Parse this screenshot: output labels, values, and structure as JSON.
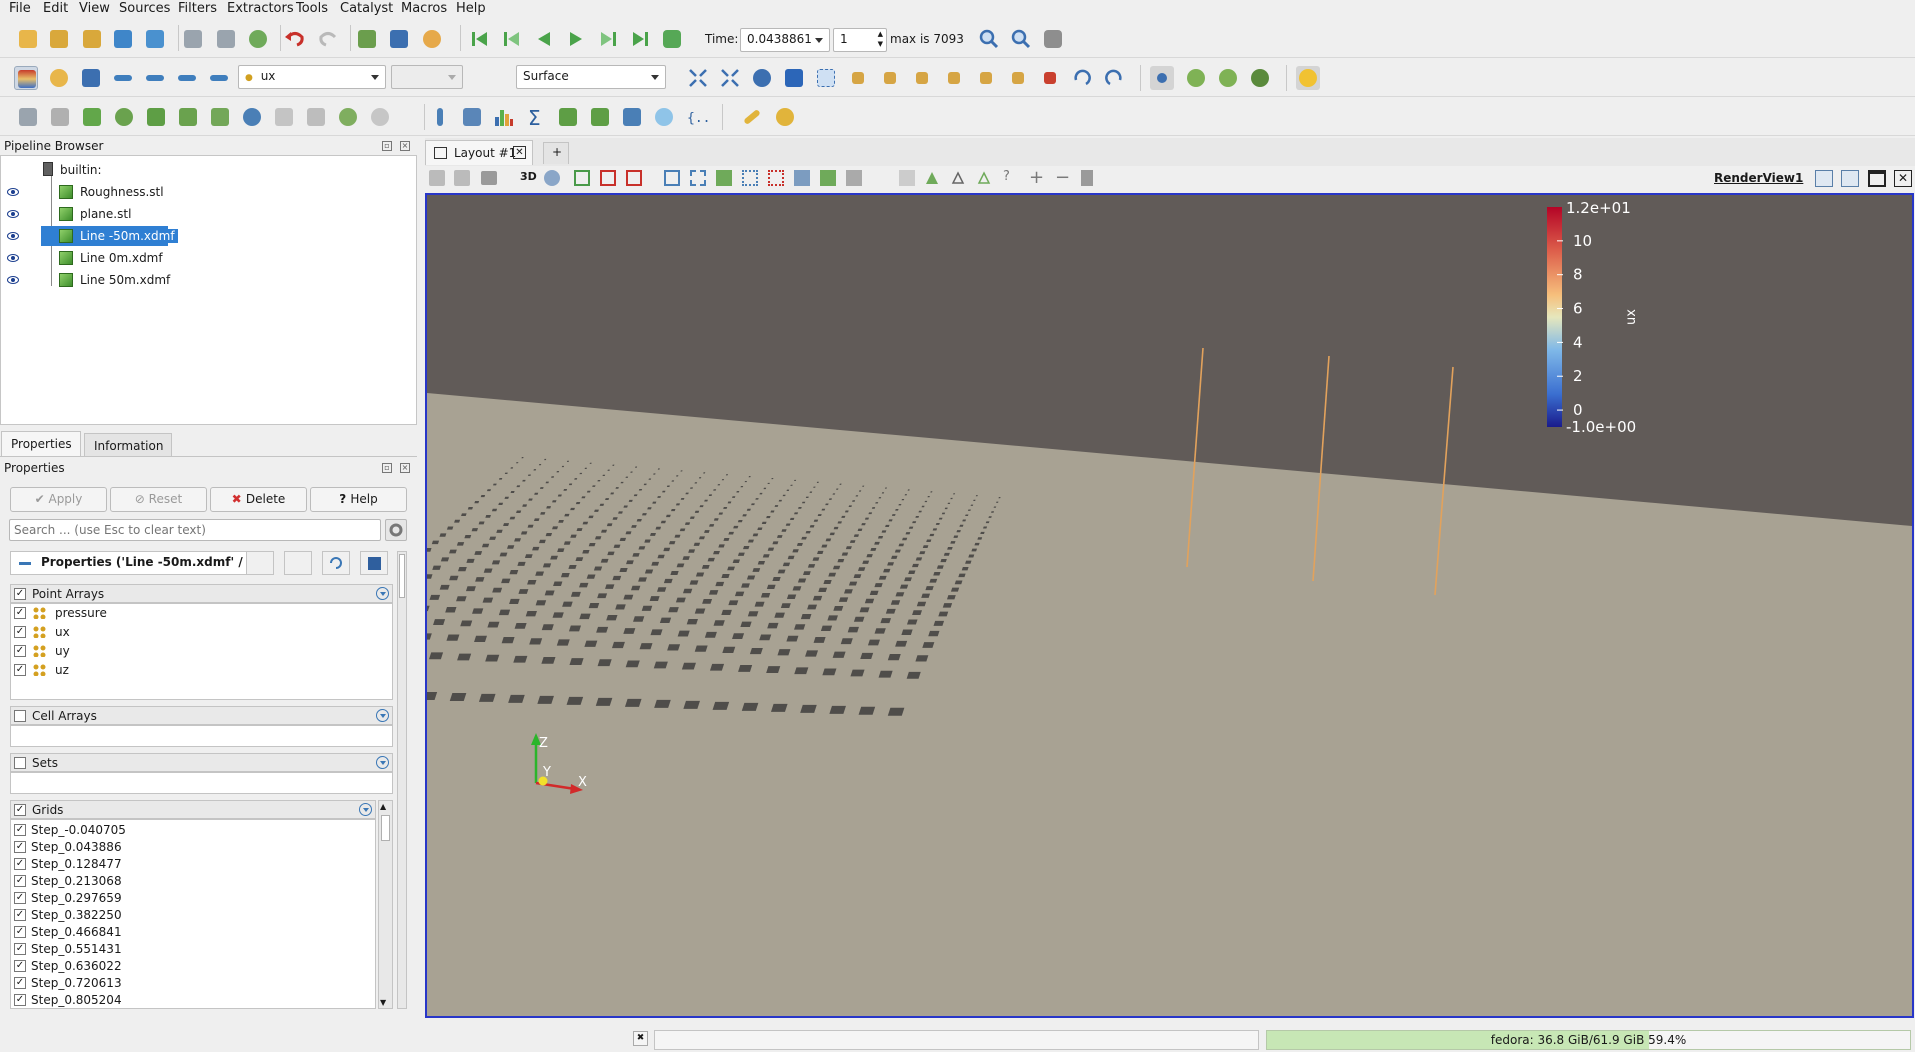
{
  "menu": [
    "File",
    "Edit",
    "View",
    "Sources",
    "Filters",
    "Extractors",
    "Tools",
    "Catalyst",
    "Macros",
    "Help"
  ],
  "time": {
    "label": "Time:",
    "value": "0.0438861",
    "step": "1",
    "max_label": "max is 7093"
  },
  "toolbar2": {
    "array_combo": "ux",
    "component_combo": "",
    "representation": "Surface"
  },
  "pipeline": {
    "title": "Pipeline Browser",
    "items": [
      {
        "label": "builtin:"
      },
      {
        "label": "Roughness.stl"
      },
      {
        "label": "plane.stl"
      },
      {
        "label": "Line -50m.xdmf"
      },
      {
        "label": "Line 0m.xdmf"
      },
      {
        "label": "Line 50m.xdmf"
      }
    ]
  },
  "tabs": {
    "properties": "Properties",
    "information": "Information"
  },
  "properties": {
    "title": "Properties",
    "apply": "Apply",
    "reset": "Reset",
    "delete": "Delete",
    "help": "Help",
    "search_placeholder": "Search ... (use Esc to clear text)",
    "group_title": "Properties ('Line -50m.xdmf' /",
    "point_arrays": {
      "label": "Point Arrays",
      "items": [
        "pressure",
        "ux",
        "uy",
        "uz"
      ]
    },
    "cell_arrays": {
      "label": "Cell Arrays"
    },
    "sets": {
      "label": "Sets"
    },
    "grids": {
      "label": "Grids",
      "items": [
        "Step_-0.040705",
        "Step_0.043886",
        "Step_0.128477",
        "Step_0.213068",
        "Step_0.297659",
        "Step_0.382250",
        "Step_0.466841",
        "Step_0.551431",
        "Step_0.636022",
        "Step_0.720613",
        "Step_0.805204"
      ]
    }
  },
  "layout": {
    "tab": "Layout #1",
    "add": "+",
    "view_name": "RenderView1",
    "mode_3d": "3D"
  },
  "colorbar": {
    "title": "ux",
    "max_label": "1.2e+01",
    "min_label": "-1.0e+00",
    "ticks": [
      "10",
      "8",
      "6",
      "4",
      "2",
      "0"
    ]
  },
  "axes": {
    "z": "Z",
    "y": "Y",
    "x": "X"
  },
  "status": {
    "memory": "fedora: 36.8 GiB/61.9 GiB 59.4%",
    "memory_fraction": 0.594
  },
  "colors": {
    "accent": "#2f7fd3",
    "view_border": "#2836c8",
    "sky": "#615b58",
    "ground": "#a8a293"
  }
}
